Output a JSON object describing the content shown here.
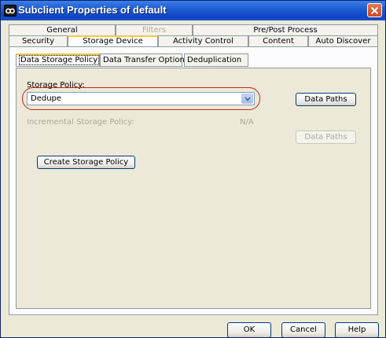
{
  "window": {
    "title": "Subclient Properties of default",
    "icon": "commvault-logo-icon",
    "close_icon": "close-icon"
  },
  "tabs_row_top": [
    "General",
    "Filters",
    "Pre/Post Process"
  ],
  "tabs_row_bottom": [
    "Security",
    "Storage Device",
    "Activity Control",
    "Content",
    "Auto Discover"
  ],
  "active_tab": "Storage Device",
  "disabled_tabs": [
    "Filters"
  ],
  "subtabs": [
    "Data Storage Policy",
    "Data Transfer Option",
    "Deduplication"
  ],
  "active_subtab": "Data Storage Policy",
  "storage_policy": {
    "label": "Storage Policy:",
    "selected_value": "Dedupe",
    "data_paths_label": "Data Paths"
  },
  "incremental": {
    "label": "Incremental Storage Policy:",
    "value": "N/A",
    "data_paths_label": "Data Paths",
    "enabled": false
  },
  "create_policy_label": "Create Storage Policy",
  "footer": {
    "ok_label": "OK",
    "cancel_label": "Cancel",
    "help_label": "Help"
  },
  "colors": {
    "title_bar": "#1c58d0",
    "active_tab_accent": "#ffc83c",
    "highlight_ring": "#cc2020",
    "close_button": "#d2451e"
  }
}
